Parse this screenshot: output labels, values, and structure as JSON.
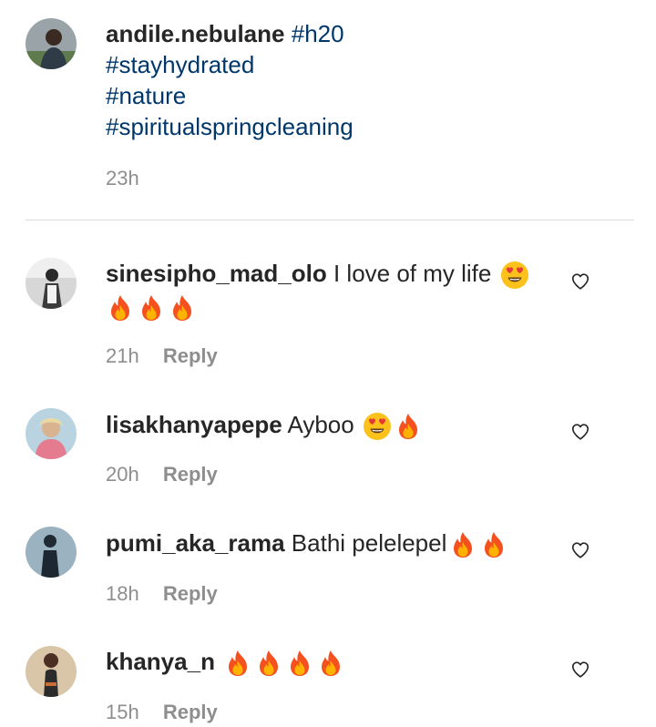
{
  "caption": {
    "username": "andile.nebulane",
    "hashtags": [
      "#h20",
      "#stayhydrated",
      "#nature",
      "#spiritualspringcleaning"
    ],
    "time": "23h"
  },
  "comments": [
    {
      "username": "sinesipho_mad_olo",
      "text": "I love of my life",
      "emojis": [
        "heart-eyes",
        "fire",
        "fire",
        "fire"
      ],
      "time": "21h",
      "reply": "Reply"
    },
    {
      "username": "lisakhanyapepe",
      "text": "Ayboo",
      "emojis": [
        "heart-eyes",
        "fire"
      ],
      "time": "20h",
      "reply": "Reply"
    },
    {
      "username": "pumi_aka_rama",
      "text": "Bathi pelelepel",
      "emojis": [
        "fire",
        "fire"
      ],
      "time": "18h",
      "reply": "Reply"
    },
    {
      "username": "khanya_n",
      "text": "",
      "emojis": [
        "fire",
        "fire",
        "fire",
        "fire"
      ],
      "time": "15h",
      "reply": "Reply"
    }
  ],
  "colors": {
    "link": "#00376b",
    "meta": "#8e8e8e",
    "text": "#262626",
    "divider": "#dbdbdb"
  }
}
